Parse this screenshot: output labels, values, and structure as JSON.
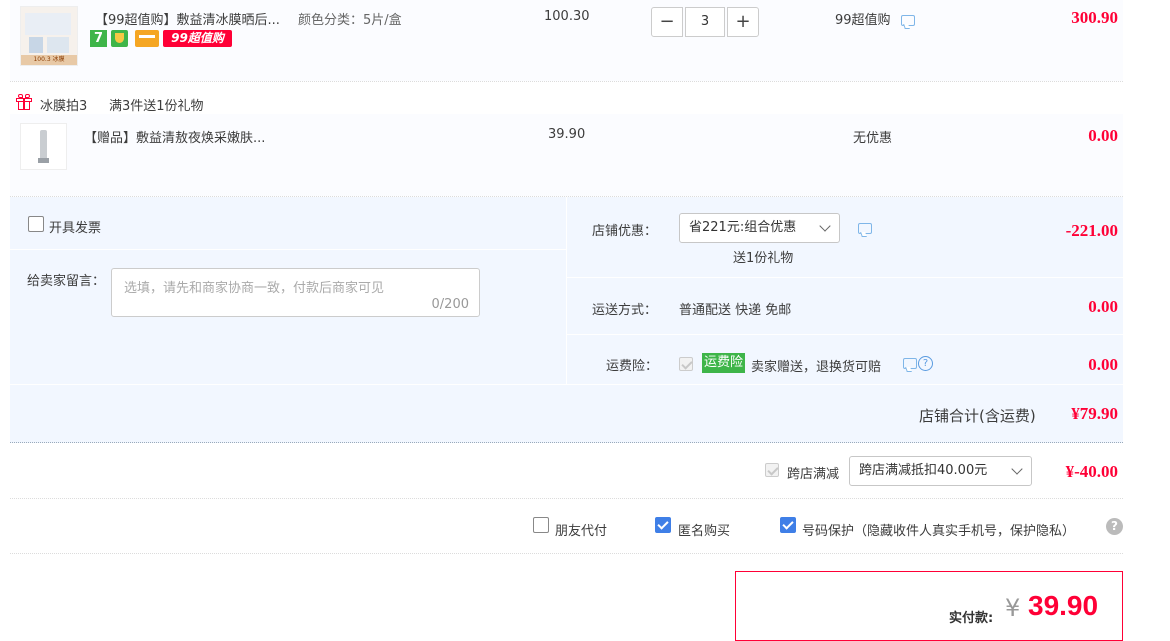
{
  "items": [
    {
      "title": "【99超值购】敷益清冰膜晒后...",
      "sku": "颜色分类：5片/盒",
      "unit_price": "100.30",
      "quantity": "3",
      "minus": "−",
      "plus": "+",
      "promo": "99超值购",
      "subtotal": "300.90",
      "badge_seven": "7",
      "badge_99": "99超值购",
      "thumb_text": "100.3 冰膜"
    }
  ],
  "gift_group": {
    "label": "冰膜拍3",
    "rule": "满3件送1份礼物",
    "item": {
      "title": "【赠品】敷益清敖夜焕采嫩肤...",
      "unit_price": "39.90",
      "promo": "无优惠",
      "subtotal": "0.00"
    }
  },
  "invoice": {
    "label": "开具发票"
  },
  "message": {
    "label": "给卖家留言：",
    "placeholder": "选填，请先和商家协商一致，付款后商家可见",
    "counter": "0/200"
  },
  "discount": {
    "label": "店铺优惠：",
    "selected": "省221元:组合优惠",
    "sub": "送1份礼物",
    "amount": "-221.00"
  },
  "shipping": {
    "label": "运送方式：",
    "value": "普通配送 快递 免邮",
    "amount": "0.00"
  },
  "insurance": {
    "label": "运费险：",
    "badge": "运费险",
    "text": "卖家赠送，退换货可赔",
    "help": "?",
    "amount": "0.00"
  },
  "store_total": {
    "label": "店铺合计(含运费)",
    "amount": "¥79.90"
  },
  "cross_store": {
    "label": "跨店满减",
    "selected": "跨店满减抵扣40.00元",
    "amount": "¥-40.00"
  },
  "options": {
    "friend_pay": "朋友代付",
    "anonymous": "匿名购买",
    "number_protect": "号码保护（隐藏收件人真实手机号，保护隐私）",
    "help": "?"
  },
  "payment": {
    "label": "实付款:",
    "currency": "¥",
    "amount": "39.90"
  },
  "colors": {
    "accent": "#ff0036",
    "checkbox": "#3f7fe7",
    "panel": "#f2f7ff"
  }
}
